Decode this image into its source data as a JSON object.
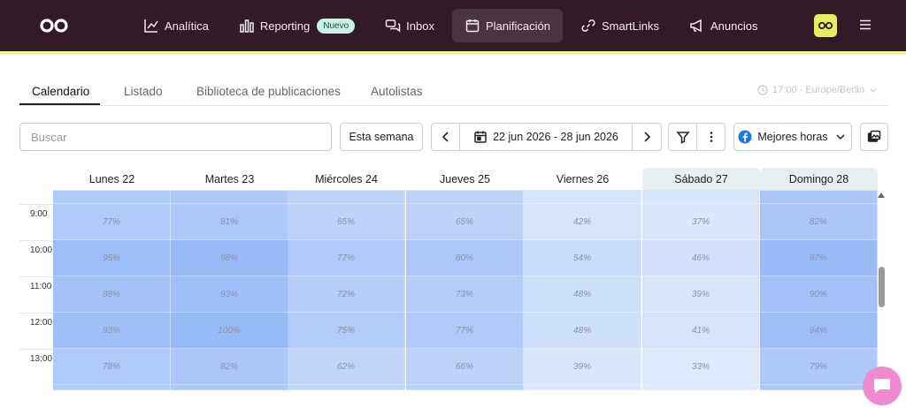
{
  "nav": {
    "items": [
      {
        "label": "Analítica",
        "icon": "chart-line-icon"
      },
      {
        "label": "Reporting",
        "icon": "bar-chart-icon",
        "badge": "Nuevo"
      },
      {
        "label": "Inbox",
        "icon": "chat-bubbles-icon"
      },
      {
        "label": "Planificación",
        "icon": "calendar-icon",
        "active": true
      },
      {
        "label": "SmartLinks",
        "icon": "link-icon"
      },
      {
        "label": "Anuncios",
        "icon": "megaphone-icon"
      }
    ],
    "colors": {
      "bar": "#311b27",
      "accent": "#e9f98a",
      "active": "#4a3440"
    }
  },
  "tabs": {
    "items": [
      "Calendario",
      "Listado",
      "Biblioteca de publicaciones",
      "Autolistas"
    ],
    "active": "Calendario",
    "timezone": "17:00 - Europe/Berlin"
  },
  "toolbar": {
    "search_placeholder": "Buscar",
    "this_week": "Esta semana",
    "date_range": "22 jun 2026 - 28 jun 2026",
    "best_times": "Mejores horas"
  },
  "calendar": {
    "days": [
      {
        "label": "Lunes 22",
        "weekend": false
      },
      {
        "label": "Martes 23",
        "weekend": false
      },
      {
        "label": "Miércoles 24",
        "weekend": false
      },
      {
        "label": "Jueves 25",
        "weekend": false
      },
      {
        "label": "Viernes 26",
        "weekend": false
      },
      {
        "label": "Sábado 27",
        "weekend": true
      },
      {
        "label": "Domingo 28",
        "weekend": true
      }
    ],
    "hours": [
      "9:00",
      "10:00",
      "11:00",
      "12:00",
      "13:00"
    ],
    "values": [
      [
        "77%",
        "81%",
        "65%",
        "65%",
        "42%",
        "37%",
        "82%"
      ],
      [
        "95%",
        "98%",
        "77%",
        "80%",
        "54%",
        "46%",
        "97%"
      ],
      [
        "88%",
        "93%",
        "72%",
        "73%",
        "48%",
        "39%",
        "90%"
      ],
      [
        "93%",
        "100%",
        "75%",
        "77%",
        "48%",
        "41%",
        "94%"
      ],
      [
        "78%",
        "82%",
        "62%",
        "66%",
        "39%",
        "33%",
        "79%"
      ]
    ]
  }
}
